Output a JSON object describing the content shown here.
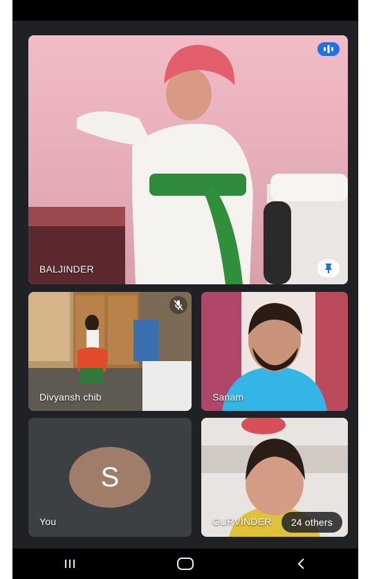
{
  "participants": {
    "main": {
      "name": "BALJINDER"
    },
    "tile2": {
      "name": "Divyansh chib"
    },
    "tile3": {
      "name": "Sanam"
    },
    "tile4": {
      "name": "You",
      "avatar_initial": "S",
      "avatar_color": "#a07d68"
    },
    "tile5": {
      "name": "GURVINDER"
    }
  },
  "others": {
    "label": "24 others"
  },
  "icons": {
    "speaking": "audio-level-icon",
    "pin": "pin-icon",
    "muted": "mic-off-icon",
    "nav_recents": "recents-icon",
    "nav_home": "home-icon",
    "nav_back": "back-icon"
  },
  "colors": {
    "background": "#202124",
    "speaking_badge": "#1a73e8"
  }
}
